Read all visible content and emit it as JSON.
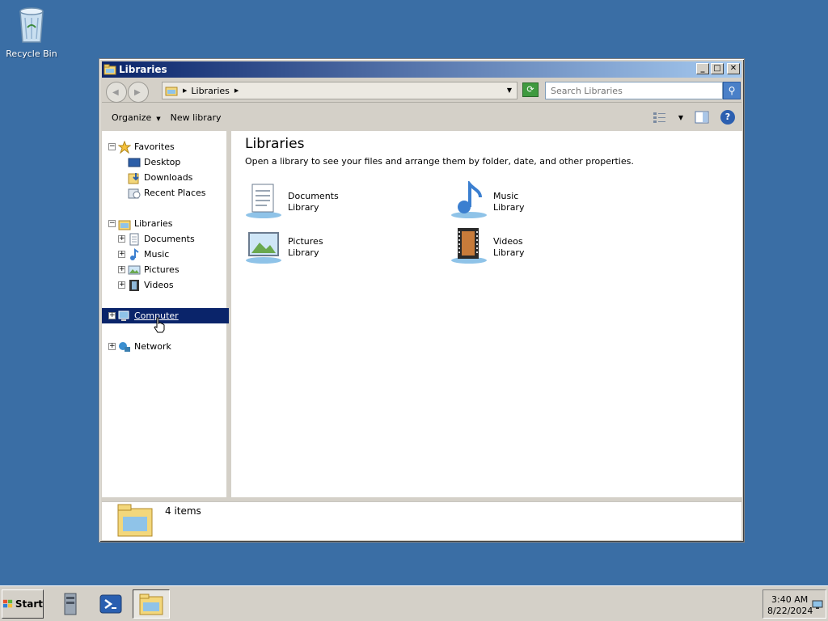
{
  "desktop": {
    "recycle_bin_label": "Recycle Bin"
  },
  "window": {
    "title": "Libraries",
    "controls": {
      "minimize": "_",
      "maximize": "□",
      "close": "✕"
    }
  },
  "address": {
    "breadcrumb": "Libraries",
    "search_placeholder": "Search Libraries"
  },
  "toolbar": {
    "organize": "Organize",
    "new_library": "New library"
  },
  "nav": {
    "favorites": {
      "label": "Favorites",
      "items": [
        "Desktop",
        "Downloads",
        "Recent Places"
      ]
    },
    "libraries": {
      "label": "Libraries",
      "items": [
        "Documents",
        "Music",
        "Pictures",
        "Videos"
      ]
    },
    "computer": "Computer",
    "network": "Network"
  },
  "content": {
    "title": "Libraries",
    "description": "Open a library to see your files and arrange them by folder, date, and other properties.",
    "libraries": [
      {
        "name": "Documents",
        "type": "Library",
        "icon": "documents-library-icon"
      },
      {
        "name": "Music",
        "type": "Library",
        "icon": "music-library-icon"
      },
      {
        "name": "Pictures",
        "type": "Library",
        "icon": "pictures-library-icon"
      },
      {
        "name": "Videos",
        "type": "Library",
        "icon": "videos-library-icon"
      }
    ]
  },
  "details": {
    "count": "4 items"
  },
  "taskbar": {
    "start_label": "Start",
    "time": "3:40 AM",
    "date": "8/22/2024"
  },
  "colors": {
    "desktop": "#3a6ea5",
    "title_gradient_start": "#0a246a",
    "title_gradient_end": "#a6caf0",
    "selection": "#0a246a"
  }
}
